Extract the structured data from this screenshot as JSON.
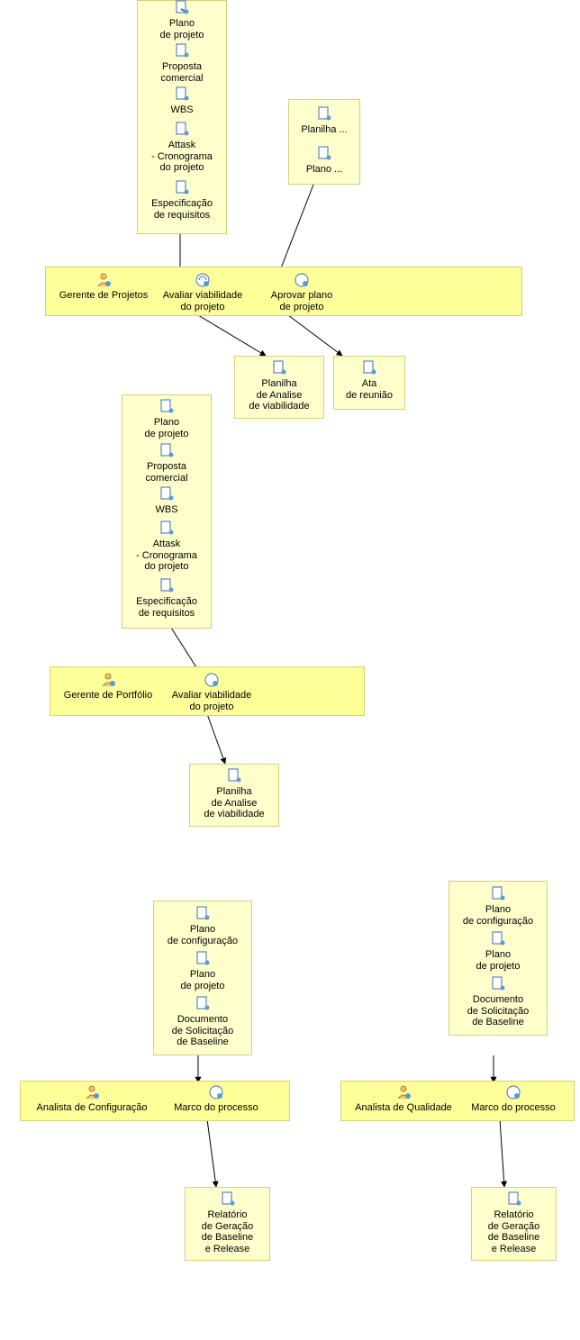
{
  "block1": {
    "items": [
      "Plano\nde projeto",
      "Proposta\ncomercial",
      "WBS",
      "Attask\n- Cronograma\ndo projeto",
      "Especificação\nde requisitos"
    ]
  },
  "block2": {
    "items": [
      "Planilha ...",
      "Plano ..."
    ]
  },
  "lane1": {
    "role": "Gerente de Projetos",
    "task1": "Avaliar viabilidade\ndo projeto",
    "task2": "Aprovar plano\nde projeto"
  },
  "out1a": "Planilha\nde Analise\nde viabilidade",
  "out1b": "Ata\nde reunião",
  "block3": {
    "items": [
      "Plano\nde projeto",
      "Proposta\ncomercial",
      "WBS",
      "Attask\n- Cronograma\ndo projeto",
      "Especificação\nde requisitos"
    ]
  },
  "lane2": {
    "role": "Gerente de Portfólio",
    "task": "Avaliar viabilidade\ndo projeto"
  },
  "out2": "Planilha\nde Analise\nde viabilidade",
  "block4": {
    "items": [
      "Plano\nde configuração",
      "Plano\nde projeto",
      "Documento\nde Solicitação\nde Baseline"
    ]
  },
  "lane3": {
    "role": "Analista de Configuração",
    "task": "Marco do processo"
  },
  "out3": "Relatório\nde Geração\nde Baseline\ne Release",
  "block5": {
    "items": [
      "Plano\nde configuração",
      "Plano\nde projeto",
      "Documento\nde Solicitação\nde Baseline"
    ]
  },
  "lane4": {
    "role": "Analista de Qualidade",
    "task": "Marco do processo"
  },
  "out4": "Relatório\nde Geração\nde Baseline\ne Release"
}
